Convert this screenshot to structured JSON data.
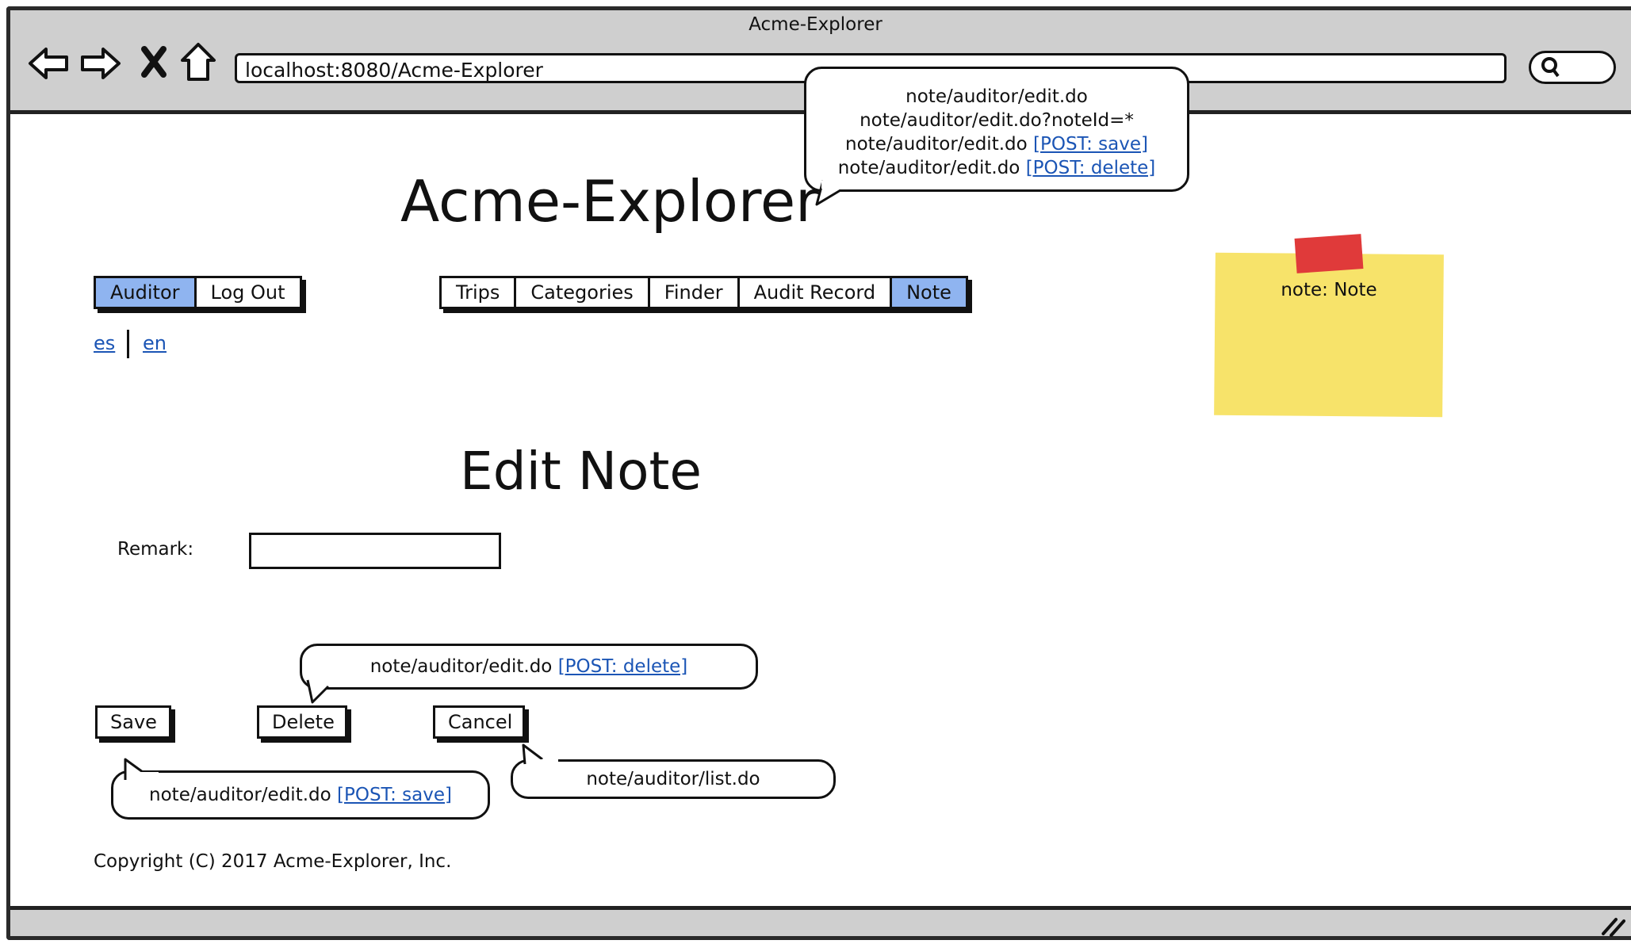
{
  "window": {
    "title": "Acme-Explorer",
    "url": "localhost:8080/Acme-Explorer"
  },
  "browser_controls": {
    "back": "back-arrow-icon",
    "forward": "forward-arrow-icon",
    "stop": "close-icon",
    "home": "home-icon",
    "search": "search-icon"
  },
  "top_bubble": {
    "line1": "note/auditor/edit.do",
    "line2": "note/auditor/edit.do?noteId=*",
    "line3_prefix": "note/auditor/edit.do ",
    "line3_link": "[POST: save]",
    "line4_prefix": "note/auditor/edit.do ",
    "line4_link": "[POST: delete]"
  },
  "app_title": "Acme-Explorer",
  "user_menu": {
    "items": [
      "Auditor",
      "Log Out"
    ],
    "selected": "Auditor"
  },
  "main_menu": {
    "items": [
      "Trips",
      "Categories",
      "Finder",
      "Audit Record",
      "Note"
    ],
    "selected": "Note"
  },
  "languages": [
    "es",
    "en"
  ],
  "sticky_note": {
    "label": "note: Note",
    "color": "#f7e36a",
    "tape_color": "#e03a3a"
  },
  "page": {
    "heading": "Edit Note",
    "remark_label": "Remark:",
    "remark_value": ""
  },
  "buttons": {
    "save": "Save",
    "delete": "Delete",
    "cancel": "Cancel"
  },
  "delete_bubble": {
    "prefix": "note/auditor/edit.do ",
    "link": "[POST: delete]"
  },
  "save_bubble": {
    "prefix": "note/auditor/edit.do ",
    "link": "[POST: save]"
  },
  "cancel_bubble": {
    "text": "note/auditor/list.do"
  },
  "footer": {
    "copyright": "Copyright (C) 2017 Acme-Explorer, Inc."
  },
  "colors": {
    "selected_tab": "#8fb4f0",
    "link": "#1b55b5",
    "chrome": "#cfcfcf"
  }
}
